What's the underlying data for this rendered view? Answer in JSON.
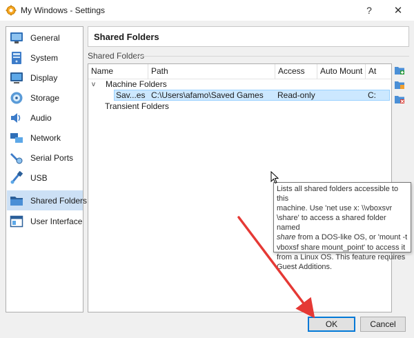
{
  "window": {
    "title": "My Windows - Settings",
    "help_glyph": "?",
    "close_glyph": "✕"
  },
  "sidebar": {
    "items": [
      {
        "label": "General",
        "icon": "general-icon"
      },
      {
        "label": "System",
        "icon": "system-icon"
      },
      {
        "label": "Display",
        "icon": "display-icon"
      },
      {
        "label": "Storage",
        "icon": "storage-icon"
      },
      {
        "label": "Audio",
        "icon": "audio-icon"
      },
      {
        "label": "Network",
        "icon": "network-icon"
      },
      {
        "label": "Serial Ports",
        "icon": "serial-ports-icon"
      },
      {
        "label": "USB",
        "icon": "usb-icon"
      },
      {
        "label": "Shared Folders",
        "icon": "shared-folders-icon",
        "selected": true
      },
      {
        "label": "User Interface",
        "icon": "user-interface-icon"
      }
    ]
  },
  "page": {
    "title": "Shared Folders",
    "group_label": "Shared Folders"
  },
  "table": {
    "columns": [
      "Name",
      "Path",
      "Access",
      "Auto Mount",
      "At"
    ],
    "groups": [
      {
        "label": "Machine Folders",
        "expanded": true,
        "expander": "v",
        "rows": [
          {
            "name": "Sav...es",
            "path": "C:\\Users\\afamo\\Saved Games",
            "access": "Read-only",
            "auto_mount": "",
            "at": "C:"
          }
        ]
      },
      {
        "label": "Transient Folders"
      }
    ]
  },
  "tooltip": {
    "line1": "Lists all shared folders accessible to this",
    "line2": "machine. Use 'net use x: \\\\vboxsvr",
    "line3a": "\\share' to access a shared folder named",
    "line4_em": "share",
    "line4b": " from a DOS-like OS, or 'mount -t",
    "line5": "vboxsf share mount_point' to access it",
    "line6": "from a Linux OS. This feature requires",
    "line7": "Guest Additions."
  },
  "buttons": {
    "ok": "OK",
    "cancel": "Cancel"
  },
  "colors": {
    "accent": "#0078d7",
    "selection": "#cce8ff",
    "annotation_arrow": "#e53935"
  }
}
